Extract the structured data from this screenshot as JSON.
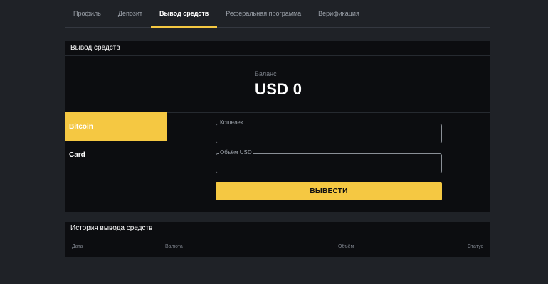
{
  "tabs": [
    {
      "label": "Профиль",
      "active": false
    },
    {
      "label": "Депозит",
      "active": false
    },
    {
      "label": "Вывод средств",
      "active": true
    },
    {
      "label": "Реферальная программа",
      "active": false
    },
    {
      "label": "Верификация",
      "active": false
    }
  ],
  "withdraw": {
    "title": "Вывод средств",
    "balance_label": "Баланс",
    "balance_value": "USD 0",
    "methods": [
      {
        "label": "Bitcoin",
        "active": true
      },
      {
        "label": "Card",
        "active": false
      }
    ],
    "wallet_label": "Кошелек",
    "wallet_value": "",
    "amount_label": "Объём USD",
    "amount_value": "",
    "submit_label": "ВЫВЕСТИ"
  },
  "history": {
    "title": "История вывода средств",
    "columns": {
      "date": "Дата",
      "currency": "Валюта",
      "amount": "Объём",
      "status": "Статус"
    }
  },
  "colors": {
    "accent": "#f5c842",
    "background": "#1f2227",
    "card": "#0c0d10"
  }
}
